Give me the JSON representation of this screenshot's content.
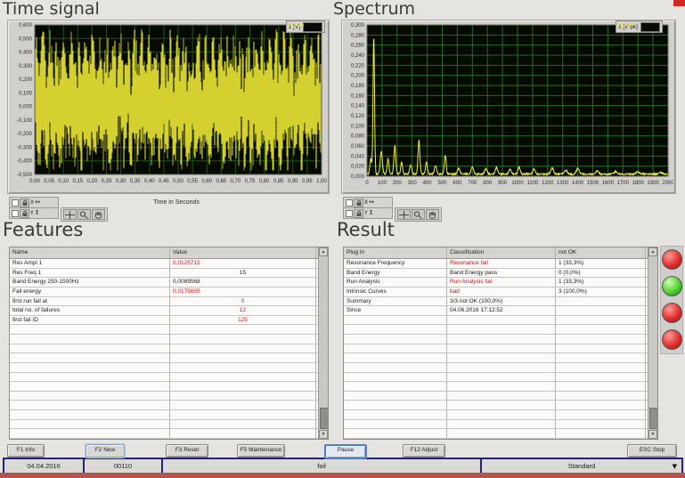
{
  "panels": {
    "time_signal": {
      "title": "Time signal",
      "legend": "1 [V]",
      "xlabel": "Time in Seconds",
      "y_ticks": [
        "0,600",
        "0,500",
        "0,400",
        "0,300",
        "0,200",
        "0,100",
        "0,000",
        "-0,100",
        "-0,200",
        "-0,300",
        "-0,400",
        "-0,500"
      ],
      "x_ticks": [
        "0,00",
        "0,05",
        "0,10",
        "0,15",
        "0,20",
        "0,25",
        "0,30",
        "0,35",
        "0,40",
        "0,45",
        "0,50",
        "0,55",
        "0,60",
        "0,65",
        "0,70",
        "0,75",
        "0,80",
        "0,85",
        "0,90",
        "0,95",
        "1,00"
      ]
    },
    "spectrum": {
      "title": "Spectrum",
      "legend": "1 [V pk]",
      "y_ticks": [
        "0,300",
        "0,280",
        "0,260",
        "0,240",
        "0,220",
        "0,200",
        "0,180",
        "0,160",
        "0,140",
        "0,120",
        "0,100",
        "0,080",
        "0,060",
        "0,040",
        "0,020",
        "0,000"
      ],
      "x_ticks": [
        "0",
        "100",
        "200",
        "300",
        "400",
        "500",
        "600",
        "700",
        "800",
        "900",
        "1000",
        "1100",
        "1200",
        "1300",
        "1400",
        "1500",
        "1600",
        "1700",
        "1800",
        "1900",
        "2000"
      ]
    },
    "features": {
      "title": "Features",
      "columns": [
        "Name",
        "Value"
      ],
      "rows": [
        {
          "name": "Res Ampl 1",
          "value": "0,0125715",
          "red": true
        },
        {
          "name": "Res Freq 1",
          "value": "15",
          "red": false
        },
        {
          "name": "Band Energy 250-1500Hz",
          "value": "0,0089568",
          "red": false
        },
        {
          "name": "Fail energy",
          "value": "0,0175605",
          "red": true
        },
        {
          "name": "first run fail at",
          "value": "0",
          "red": true
        },
        {
          "name": "total no. of failures",
          "value": "12",
          "red": true
        },
        {
          "name": "first fail ID",
          "value": "125",
          "red": true
        }
      ]
    },
    "result": {
      "title": "Result",
      "columns": [
        "Plug In",
        "Classification",
        "not OK"
      ],
      "rows": [
        {
          "plugin": "Resonance Frequency",
          "classification": "Resonance fail",
          "class_red": true,
          "not_ok": "1 (33,3%)"
        },
        {
          "plugin": "Band Energy",
          "classification": "Band Energy pass",
          "class_red": false,
          "not_ok": "0 (0,0%)"
        },
        {
          "plugin": "Run Analysis",
          "classification": "Run Analysis fail",
          "class_red": true,
          "not_ok": "1 (33,3%)"
        },
        {
          "plugin": "Intrinsic Curves",
          "classification": "bad",
          "class_red": true,
          "not_ok": "3 (100,0%)"
        },
        {
          "plugin": "Summary",
          "classification": "3/3 not OK (100,0%)",
          "class_red": false,
          "not_ok": ""
        },
        {
          "plugin": "Since",
          "classification": "04.06.2016 17:12:52",
          "class_red": false,
          "not_ok": ""
        }
      ],
      "leds": [
        "red",
        "green",
        "red",
        "red"
      ]
    }
  },
  "graph_controls": {
    "scale_rows": [
      "X",
      "Y"
    ],
    "palette_icons": [
      "crosshair-icon",
      "magnifier-icon",
      "hand-icon"
    ]
  },
  "toolbar": {
    "buttons": [
      {
        "label": "F1 Info",
        "name": "f1-info-button",
        "focus": "none"
      },
      {
        "label": "F2 New",
        "name": "f2-new-button",
        "focus": "light"
      },
      {
        "label": "F3 Reset",
        "name": "f3-reset-button",
        "focus": "none"
      },
      {
        "label": "F5 Maintenance",
        "name": "f5-maintenance-button",
        "focus": "none"
      },
      {
        "label": "Pause",
        "name": "pause-button",
        "focus": "strong"
      },
      {
        "label": "F12 Adjust",
        "name": "f12-adjust-button",
        "focus": "none"
      },
      {
        "label": "ESC Stop",
        "name": "esc-stop-button",
        "focus": "none"
      }
    ]
  },
  "statusbar": {
    "date": "04.04.2016",
    "counter": "00110",
    "status": "fail",
    "profile": "Standard",
    "dropdown_arrow_glyph": "▼"
  },
  "colors": {
    "accent_navy": "#23237c",
    "alert_red": "#c21616",
    "led_red": "#e03030",
    "led_green": "#52d22e",
    "waveform_yellow": "#f2ef3c",
    "grid_green": "#2a6b28",
    "plot_background": "#060b02",
    "bottom_bar_red": "#b8544c"
  },
  "chart_data": [
    {
      "type": "line",
      "title": "Time signal",
      "xlabel": "Time in Seconds",
      "ylabel": "",
      "legend": "1 [V]",
      "xlim": [
        0,
        1
      ],
      "ylim": [
        -0.5,
        0.6
      ],
      "grid": true,
      "plot_bg": "#060b02",
      "series": [
        {
          "name": "1 [V]",
          "color": "#f2ef3c",
          "description": "dense broadband vibration signal filling the plot; burst envelope peaks near +0,55 and troughs near -0,45, mean slightly above 0",
          "envelope_top": 0.58,
          "envelope_bottom": -0.47,
          "seed": 7
        }
      ]
    },
    {
      "type": "line",
      "title": "Spectrum",
      "xlabel": "",
      "ylabel": "",
      "legend": "1 [V pk]",
      "xlim": [
        0,
        2000
      ],
      "ylim": [
        0,
        0.3
      ],
      "grid": true,
      "plot_bg": "#060b02",
      "baseline": 0.003,
      "points": [
        {
          "x": 45,
          "y": 0.272,
          "w": 5
        },
        {
          "x": 25,
          "y": 0.03,
          "w": 6
        },
        {
          "x": 95,
          "y": 0.045,
          "w": 7
        },
        {
          "x": 140,
          "y": 0.03,
          "w": 6
        },
        {
          "x": 185,
          "y": 0.057,
          "w": 6
        },
        {
          "x": 230,
          "y": 0.023,
          "w": 6
        },
        {
          "x": 290,
          "y": 0.018,
          "w": 7
        },
        {
          "x": 345,
          "y": 0.067,
          "w": 6
        },
        {
          "x": 395,
          "y": 0.023,
          "w": 6
        },
        {
          "x": 455,
          "y": 0.017,
          "w": 7
        },
        {
          "x": 520,
          "y": 0.037,
          "w": 6
        },
        {
          "x": 610,
          "y": 0.011,
          "w": 8
        },
        {
          "x": 700,
          "y": 0.014,
          "w": 8
        },
        {
          "x": 790,
          "y": 0.011,
          "w": 8
        },
        {
          "x": 860,
          "y": 0.013,
          "w": 8
        },
        {
          "x": 950,
          "y": 0.009,
          "w": 8
        },
        {
          "x": 1010,
          "y": 0.013,
          "w": 8
        },
        {
          "x": 1110,
          "y": 0.01,
          "w": 8
        },
        {
          "x": 1230,
          "y": 0.012,
          "w": 9
        },
        {
          "x": 1320,
          "y": 0.008,
          "w": 9
        },
        {
          "x": 1400,
          "y": 0.011,
          "w": 9
        },
        {
          "x": 1530,
          "y": 0.006,
          "w": 9
        },
        {
          "x": 1650,
          "y": 0.005,
          "w": 9
        },
        {
          "x": 1800,
          "y": 0.004,
          "w": 10
        },
        {
          "x": 1950,
          "y": 0.003,
          "w": 10
        }
      ]
    }
  ]
}
